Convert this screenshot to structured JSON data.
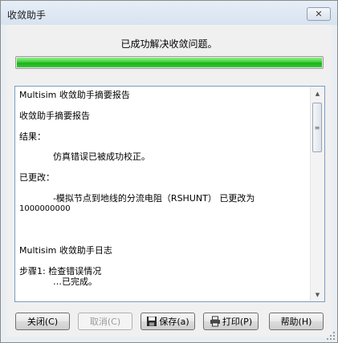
{
  "window": {
    "title": "收敛助手",
    "close_glyph": "✕"
  },
  "status": {
    "message": "已成功解决收敛问题。",
    "progress": 1.0,
    "progress_color": "#2ec42c"
  },
  "log": {
    "lines": [
      "Multisim 收敛助手摘要报告",
      "收敛助手摘要报告",
      "结果：",
      "            仿真错误已被成功校正。",
      "已更改：",
      "            -模拟节点到地线的分流电阻（RSHUNT） 已更改为",
      "1000000000",
      "Multisim 收敛助手日志",
      "步骤1: 检查错误情况",
      "            …已完成。"
    ]
  },
  "buttons": {
    "close": "关闭(C)",
    "cancel": "取消(C)",
    "save": "保存(a)",
    "print": "打印(P)",
    "help": "帮助(H)"
  },
  "icons": {
    "save": "floppy-disk-icon",
    "print": "printer-icon"
  }
}
